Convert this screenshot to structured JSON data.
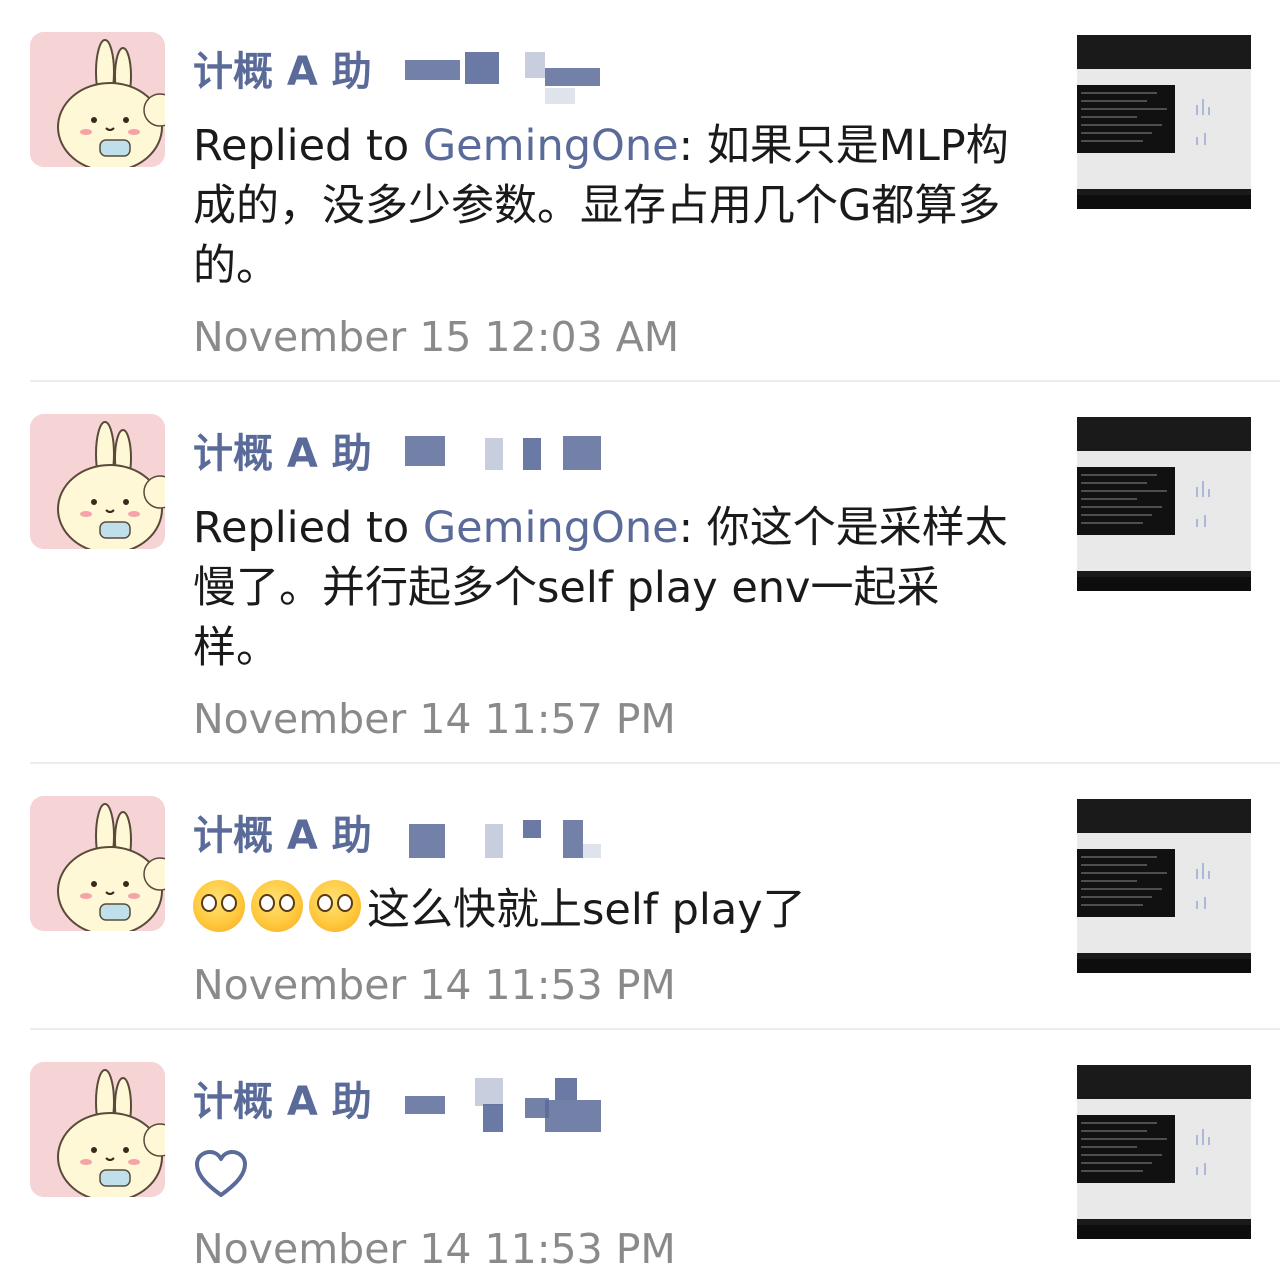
{
  "feed": {
    "entries": [
      {
        "sender": "计概 A 助",
        "reply_prefix": "Replied to ",
        "reply_to": "GemingOne",
        "text": ": 如果只是MLP构成的，没多少参数。显存占用几个G都算多的。",
        "time": "November 15 12:03 AM",
        "avatar_icon": "bunny-avatar-icon",
        "thumbnail_icon": "monitor-photo-thumbnail"
      },
      {
        "sender": "计概 A 助",
        "reply_prefix": "Replied to ",
        "reply_to": "GemingOne",
        "text": ": 你这个是采样太慢了。并行起多个self play env一起采样。",
        "time": "November 14 11:57 PM",
        "avatar_icon": "bunny-avatar-icon",
        "thumbnail_icon": "monitor-photo-thumbnail"
      },
      {
        "sender": "计概 A 助",
        "emoji_icon": "flushed-face-emoji-icon",
        "emoji_count": 3,
        "text": "这么快就上self play了",
        "time": "November 14 11:53 PM",
        "avatar_icon": "bunny-avatar-icon",
        "thumbnail_icon": "monitor-photo-thumbnail"
      },
      {
        "sender": "计概 A 助",
        "like_icon": "heart-outline-icon",
        "time": "November 14 11:53 PM",
        "avatar_icon": "bunny-avatar-icon",
        "thumbnail_icon": "monitor-photo-thumbnail"
      }
    ]
  },
  "colors": {
    "name": "#5a6b9a",
    "text": "#1a1a1a",
    "time": "#8a8a8a",
    "avatar_bg": "#f6d3d4"
  }
}
